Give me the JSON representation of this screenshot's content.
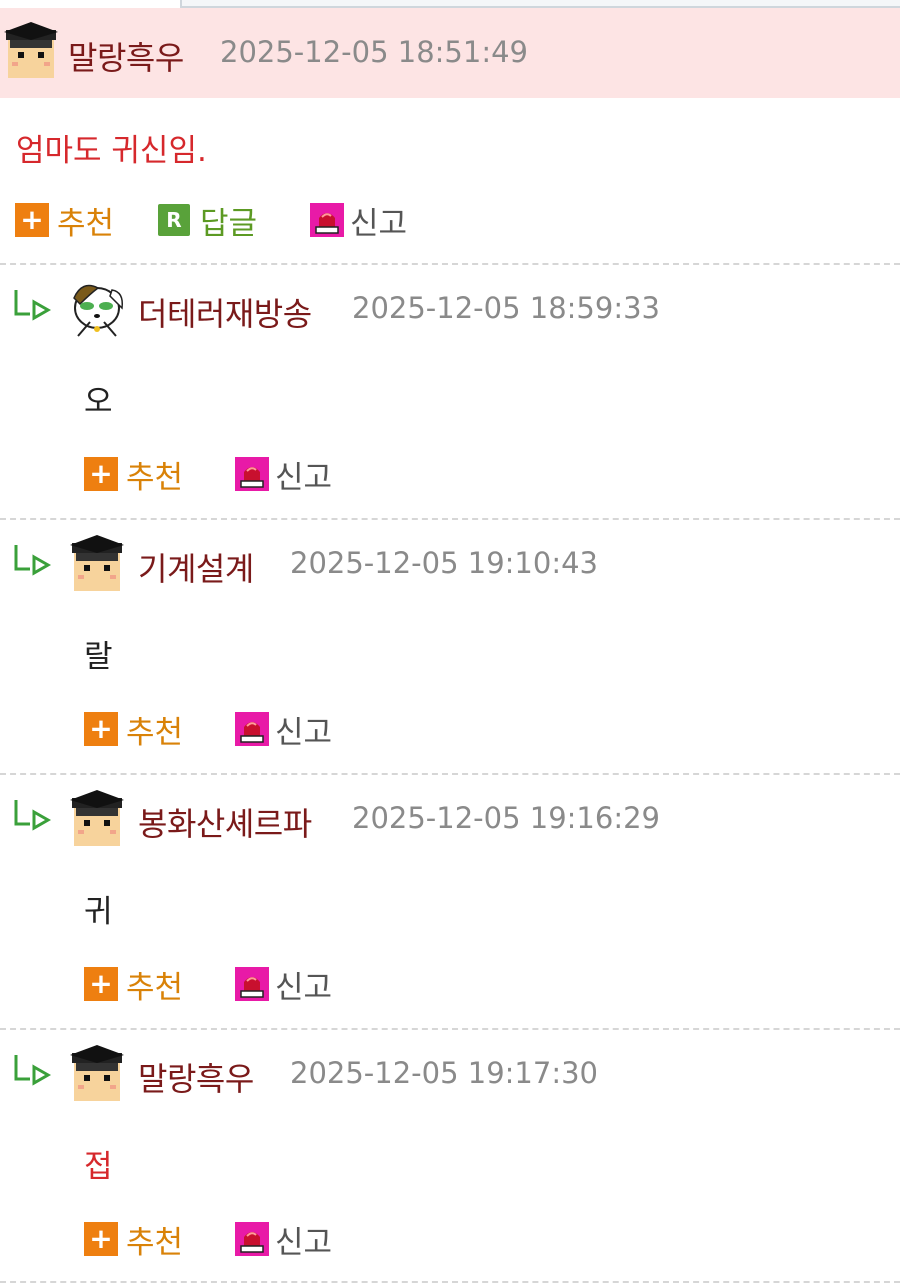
{
  "comments": [
    {
      "nick": "말랑흑우",
      "time": "2025-12-05 18:51:49",
      "body": "엄마도 귀신임.",
      "recommend_label": "추천",
      "reply_label": "답글",
      "report_label": "신고",
      "reply_icon_text": "R"
    },
    {
      "nick": "더테러재방송",
      "time": "2025-12-05 18:59:33",
      "body": "오",
      "recommend_label": "추천",
      "report_label": "신고"
    },
    {
      "nick": "기계설계",
      "time": "2025-12-05 19:10:43",
      "body": "랄",
      "recommend_label": "추천",
      "report_label": "신고"
    },
    {
      "nick": "봉화산셰르파",
      "time": "2025-12-05 19:16:29",
      "body": "귀",
      "recommend_label": "추천",
      "report_label": "신고"
    },
    {
      "nick": "말랑흑우",
      "time": "2025-12-05 19:17:30",
      "body": "접",
      "recommend_label": "추천",
      "report_label": "신고"
    }
  ],
  "icons": {
    "recommend": "plus-icon",
    "reply": "reply-r-icon",
    "report": "siren-icon",
    "reply_arrow": "reply-arrow-icon"
  },
  "colors": {
    "root_header_bg": "#fde4e4",
    "nick": "#7a1a1a",
    "time": "#8a8a8a",
    "body_red": "#d6282c",
    "recommend": "#d98208",
    "reply": "#5c9a23"
  }
}
